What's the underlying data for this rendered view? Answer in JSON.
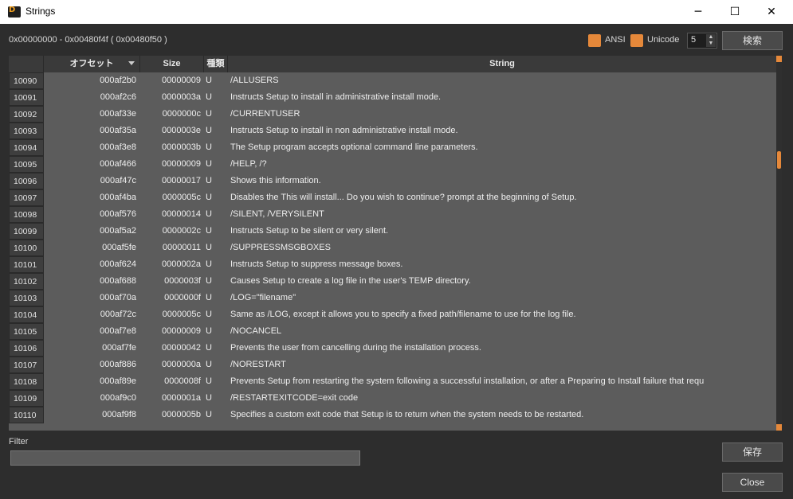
{
  "window": {
    "title": "Strings",
    "logo_text": "D",
    "min_glyph": "─",
    "max_glyph": "☐",
    "close_glyph": "✕"
  },
  "toolbar": {
    "range": "0x00000000 - 0x00480f4f ( 0x00480f50 )",
    "ansi_label": "ANSI",
    "unicode_label": "Unicode",
    "min_length": "5",
    "search_label": "検索",
    "accent_color": "#e5883a"
  },
  "table": {
    "columns": {
      "offset": "オフセット",
      "size": "Size",
      "type": "種類",
      "string": "String"
    },
    "rows": [
      {
        "idx": "10090",
        "offset": "000af2b0",
        "size": "00000009",
        "type": "U",
        "string": "/ALLUSERS"
      },
      {
        "idx": "10091",
        "offset": "000af2c6",
        "size": "0000003a",
        "type": "U",
        "string": "Instructs Setup to install in administrative install mode."
      },
      {
        "idx": "10092",
        "offset": "000af33e",
        "size": "0000000c",
        "type": "U",
        "string": "/CURRENTUSER"
      },
      {
        "idx": "10093",
        "offset": "000af35a",
        "size": "0000003e",
        "type": "U",
        "string": "Instructs Setup to install in non administrative install mode."
      },
      {
        "idx": "10094",
        "offset": "000af3e8",
        "size": "0000003b",
        "type": "U",
        "string": "The Setup program accepts optional command line parameters."
      },
      {
        "idx": "10095",
        "offset": "000af466",
        "size": "00000009",
        "type": "U",
        "string": "/HELP, /?"
      },
      {
        "idx": "10096",
        "offset": "000af47c",
        "size": "00000017",
        "type": "U",
        "string": "Shows this information."
      },
      {
        "idx": "10097",
        "offset": "000af4ba",
        "size": "0000005c",
        "type": "U",
        "string": "Disables the This will install... Do you wish to continue? prompt at the beginning of Setup."
      },
      {
        "idx": "10098",
        "offset": "000af576",
        "size": "00000014",
        "type": "U",
        "string": "/SILENT, /VERYSILENT"
      },
      {
        "idx": "10099",
        "offset": "000af5a2",
        "size": "0000002c",
        "type": "U",
        "string": "Instructs Setup to be silent or very silent."
      },
      {
        "idx": "10100",
        "offset": "000af5fe",
        "size": "00000011",
        "type": "U",
        "string": "/SUPPRESSMSGBOXES"
      },
      {
        "idx": "10101",
        "offset": "000af624",
        "size": "0000002a",
        "type": "U",
        "string": "Instructs Setup to suppress message boxes."
      },
      {
        "idx": "10102",
        "offset": "000af688",
        "size": "0000003f",
        "type": "U",
        "string": "Causes Setup to create a log file in the user's TEMP directory."
      },
      {
        "idx": "10103",
        "offset": "000af70a",
        "size": "0000000f",
        "type": "U",
        "string": "/LOG=\"filename\""
      },
      {
        "idx": "10104",
        "offset": "000af72c",
        "size": "0000005c",
        "type": "U",
        "string": "Same as /LOG, except it allows you to specify a fixed path/filename to use for the log file."
      },
      {
        "idx": "10105",
        "offset": "000af7e8",
        "size": "00000009",
        "type": "U",
        "string": "/NOCANCEL"
      },
      {
        "idx": "10106",
        "offset": "000af7fe",
        "size": "00000042",
        "type": "U",
        "string": "Prevents the user from cancelling during the installation process."
      },
      {
        "idx": "10107",
        "offset": "000af886",
        "size": "0000000a",
        "type": "U",
        "string": "/NORESTART"
      },
      {
        "idx": "10108",
        "offset": "000af89e",
        "size": "0000008f",
        "type": "U",
        "string": "Prevents Setup from restarting the system following a successful installation, or after a Preparing to Install failure that requ"
      },
      {
        "idx": "10109",
        "offset": "000af9c0",
        "size": "0000001a",
        "type": "U",
        "string": "/RESTARTEXITCODE=exit code"
      },
      {
        "idx": "10110",
        "offset": "000af9f8",
        "size": "0000005b",
        "type": "U",
        "string": "Specifies a custom exit code that Setup is to return when the system needs to be restarted."
      }
    ]
  },
  "footer": {
    "filter_label": "Filter",
    "filter_value": "",
    "save_label": "保存",
    "close_label": "Close"
  }
}
